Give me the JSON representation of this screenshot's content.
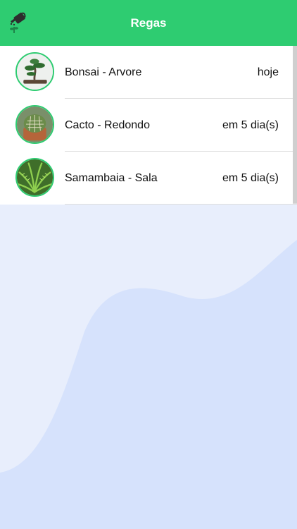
{
  "header": {
    "title": "Regas",
    "icon": "watering-can-icon",
    "color": "#2ecc71"
  },
  "plants": [
    {
      "name": "Bonsai - Arvore",
      "due": "hoje",
      "image": "bonsai-photo"
    },
    {
      "name": "Cacto - Redondo",
      "due": "em 5 dia(s)",
      "image": "cactus-photo"
    },
    {
      "name": "Samambaia - Sala",
      "due": "em 5 dia(s)",
      "image": "fern-photo"
    }
  ],
  "colors": {
    "accent": "#2ecc71",
    "background": "#e8eefc",
    "wave": "#d6e2fc"
  }
}
